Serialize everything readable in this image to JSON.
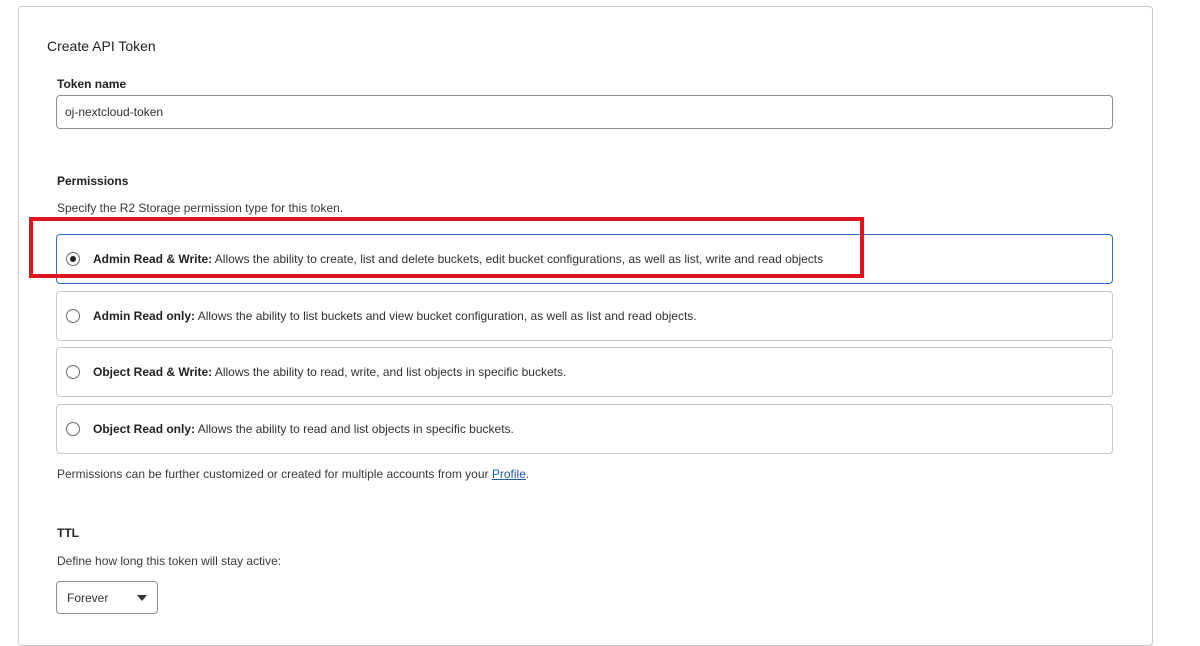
{
  "form": {
    "title": "Create API Token",
    "token_name": {
      "label": "Token name",
      "value": "oj-nextcloud-token"
    },
    "permissions": {
      "label": "Permissions",
      "description": "Specify the R2 Storage permission type for this token.",
      "options": [
        {
          "title": "Admin Read & Write:",
          "text": " Allows the ability to create, list and delete buckets, edit bucket configurations, as well as list, write and read objects",
          "selected": true
        },
        {
          "title": "Admin Read only:",
          "text": " Allows the ability to list buckets and view bucket configuration, as well as list and read objects.",
          "selected": false
        },
        {
          "title": "Object Read & Write:",
          "text": " Allows the ability to read, write, and list objects in specific buckets.",
          "selected": false
        },
        {
          "title": "Object Read only:",
          "text": " Allows the ability to read and list objects in specific buckets.",
          "selected": false
        }
      ],
      "footnote_prefix": "Permissions can be further customized or created for multiple accounts from your ",
      "footnote_link": "Profile",
      "footnote_suffix": "."
    },
    "ttl": {
      "label": "TTL",
      "description": "Define how long this token will stay active:",
      "selected": "Forever"
    }
  },
  "colors": {
    "highlight": "#e0141e",
    "selected_border": "#2f6fc7",
    "link": "#1f5ca6"
  }
}
